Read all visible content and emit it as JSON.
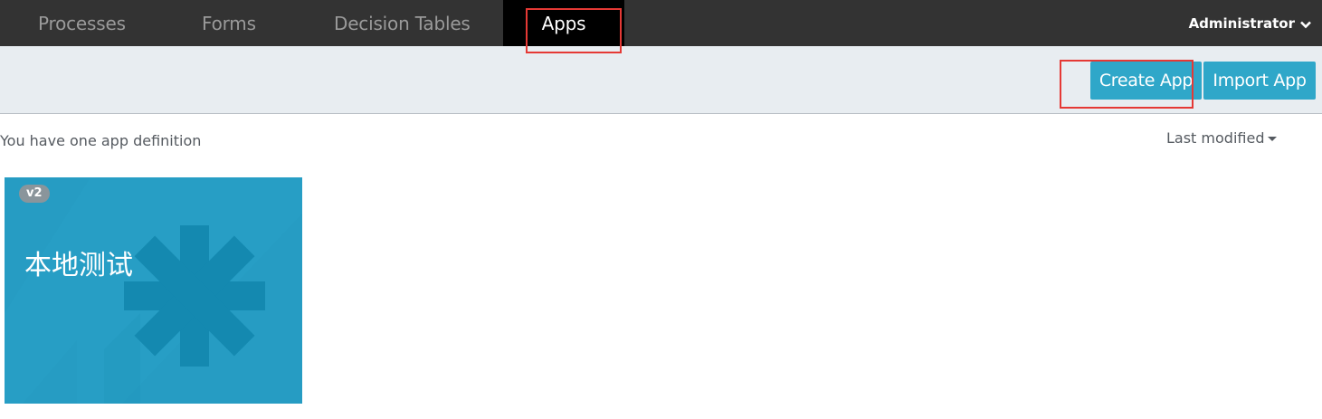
{
  "nav": {
    "tabs": [
      {
        "label": "Processes",
        "active": false
      },
      {
        "label": "Forms",
        "active": false
      },
      {
        "label": "Decision Tables",
        "active": false
      },
      {
        "label": "Apps",
        "active": true
      }
    ],
    "user": {
      "label": "Administrator",
      "icon": "chevron-down-icon"
    }
  },
  "toolbar": {
    "create_label": "Create App",
    "import_label": "Import App"
  },
  "content": {
    "summary": "You have one app definition",
    "sort_label": "Last modified",
    "apps": [
      {
        "name": "本地测试",
        "version": "v2",
        "icon": "asterisk-icon"
      }
    ]
  },
  "colors": {
    "navbar": "#333333",
    "active_tab": "#000000",
    "accent": "#2fa7c9",
    "card": "#269cc3",
    "highlight": "#e53935"
  }
}
